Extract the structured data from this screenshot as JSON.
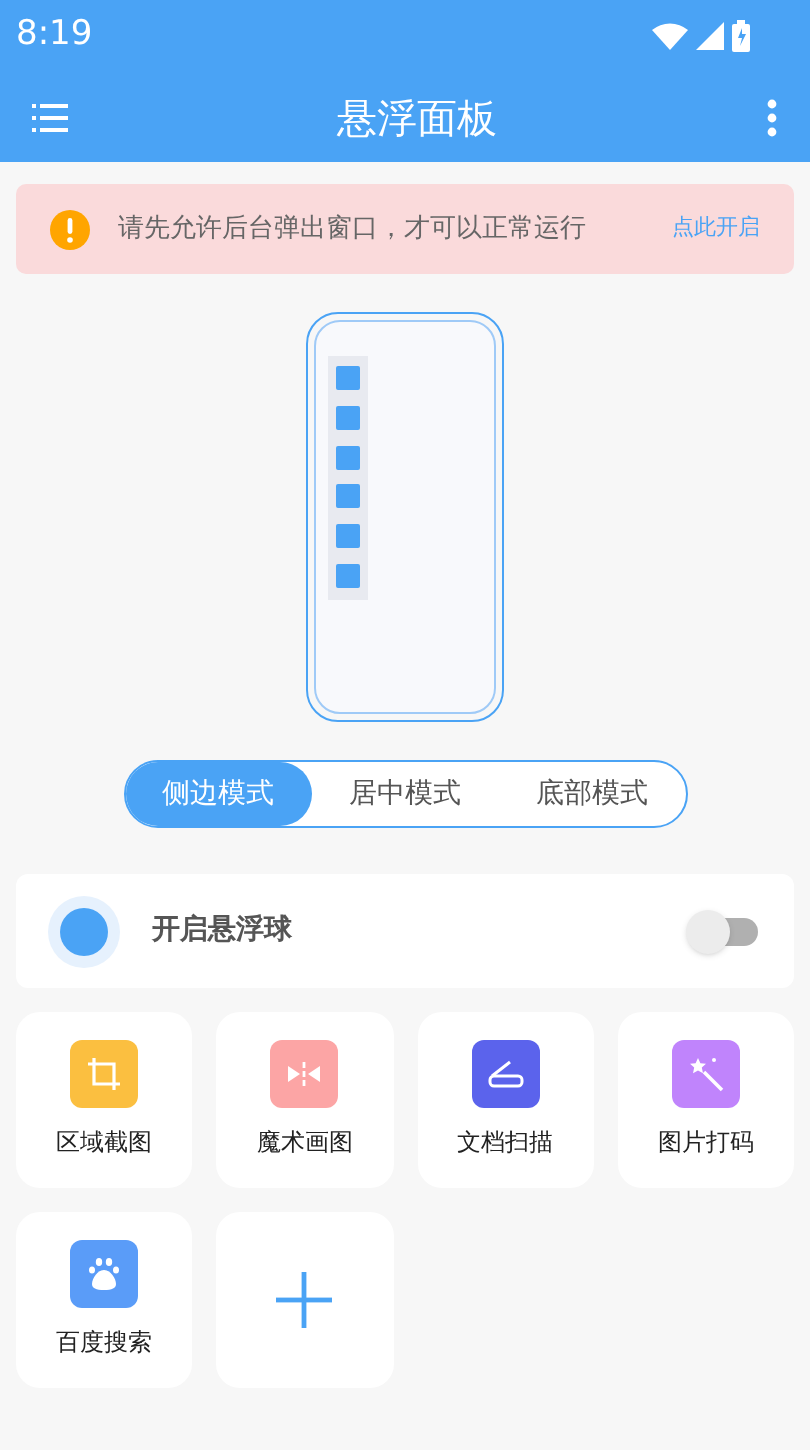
{
  "status_bar": {
    "time": "8:19"
  },
  "app_bar": {
    "title": "悬浮面板"
  },
  "notice": {
    "text": "请先允许后台弹出窗口，才可以正常运行",
    "action": "点此开启"
  },
  "modes": [
    {
      "label": "侧边模式",
      "selected": true
    },
    {
      "label": "居中模式",
      "selected": false
    },
    {
      "label": "底部模式",
      "selected": false
    }
  ],
  "float_ball": {
    "label": "开启悬浮球",
    "on": false
  },
  "tools": [
    {
      "kind": "crop",
      "label": "区域截图",
      "color": "#fbbf40"
    },
    {
      "kind": "split",
      "label": "魔术画图",
      "color": "#fca5a5"
    },
    {
      "kind": "scan",
      "label": "文档扫描",
      "color": "#5b63ec"
    },
    {
      "kind": "magic",
      "label": "图片打码",
      "color": "#c084fc"
    },
    {
      "kind": "paw",
      "label": "百度搜索",
      "color": "#5a9cf8"
    },
    {
      "kind": "add"
    }
  ]
}
